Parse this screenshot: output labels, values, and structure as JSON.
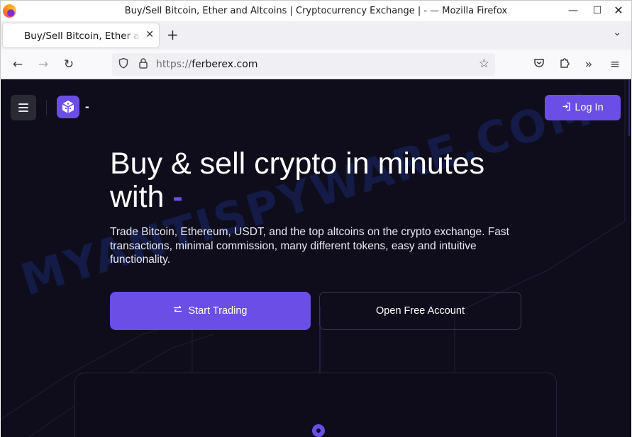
{
  "window": {
    "title": "Buy/Sell Bitcoin, Ether and Altcoins | Cryptocurrency Exchange | - — Mozilla Firefox",
    "minimize_icon": "minimize-icon",
    "maximize_icon": "maximize-icon",
    "close_icon": "close-icon"
  },
  "tabs": [
    {
      "label": "Buy/Sell Bitcoin, Ether and Altcoins | Cryptocurrency Exchange | -",
      "active": true
    }
  ],
  "toolbar": {
    "url_protocol": "https://",
    "url_domain": "ferberex.com"
  },
  "page": {
    "site_name": "-",
    "login_label": "Log In",
    "hero_title_line1": "Buy & sell crypto in minutes",
    "hero_title_line2": "with",
    "hero_title_accent": "-",
    "hero_description": "Trade Bitcoin, Ethereum, USDT, and the top altcoins on the crypto exchange. Fast transactions, minimal commission, many different tokens, easy and intuitive functionality.",
    "start_trading_label": "Start Trading",
    "open_account_label": "Open Free Account",
    "watermark": "MYANTISPYWARE.COM"
  },
  "colors": {
    "page_background": "#0f0d1c",
    "accent": "#6b4ee6",
    "text": "#ffffff"
  }
}
